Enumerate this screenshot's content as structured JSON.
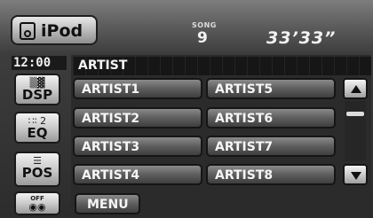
{
  "source": {
    "label": "iPod",
    "icon": "ipod-icon"
  },
  "song": {
    "caption": "SONG",
    "number": "9"
  },
  "time": "33’33”",
  "clock": "12:00",
  "side_buttons": [
    {
      "label": "DSP",
      "icon": "dsp-icon",
      "glyph": "▒▓"
    },
    {
      "label": "EQ",
      "icon": "eq-icon",
      "glyph": "∷∶ 2"
    },
    {
      "label": "POS",
      "icon": "position-icon",
      "glyph": "☰"
    },
    {
      "label": "OFF",
      "icon": "speaker-off-icon",
      "glyph": "◉◉"
    }
  ],
  "list": {
    "header": "ARTIST",
    "items": [
      "ARTIST1",
      "ARTIST2",
      "ARTIST3",
      "ARTIST4",
      "ARTIST5",
      "ARTIST6",
      "ARTIST7",
      "ARTIST8"
    ]
  },
  "scroll": {
    "up_icon": "chevron-up-icon",
    "down_icon": "chevron-down-icon"
  },
  "footer": {
    "menu_label": "MENU"
  },
  "colors": {
    "background": "#2c2c2c",
    "button_light": "#c6c6c6",
    "button_dark": "#5e5e5e",
    "text": "#f6f6f6"
  }
}
